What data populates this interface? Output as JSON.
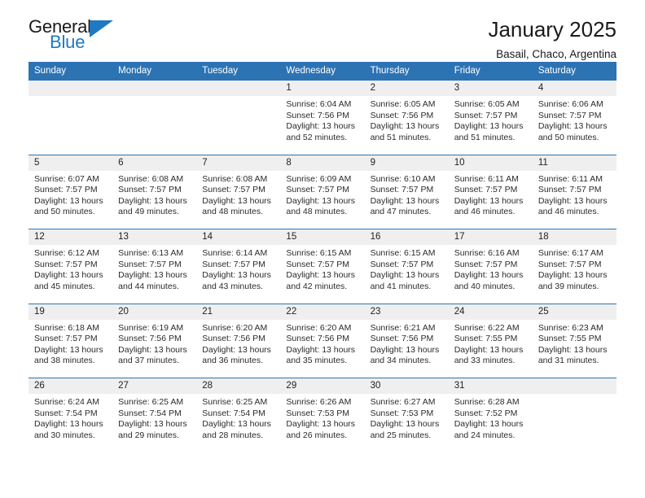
{
  "brand": {
    "name_top": "General",
    "name_bottom": "Blue",
    "triangle_color": "#1f78c1"
  },
  "header": {
    "title": "January 2025",
    "subtitle": "Basail, Chaco, Argentina"
  },
  "theme": {
    "header_blue": "#2c73b4",
    "date_band_gray": "#efefef",
    "text_dark": "#1a1a1a"
  },
  "calendar": {
    "weekdays": [
      "Sunday",
      "Monday",
      "Tuesday",
      "Wednesday",
      "Thursday",
      "Friday",
      "Saturday"
    ],
    "weeks": [
      [
        {
          "day": "",
          "empty": true,
          "lines": []
        },
        {
          "day": "",
          "empty": true,
          "lines": []
        },
        {
          "day": "",
          "empty": true,
          "lines": []
        },
        {
          "day": "1",
          "empty": false,
          "lines": [
            "Sunrise: 6:04 AM",
            "Sunset: 7:56 PM",
            "Daylight: 13 hours",
            "and 52 minutes."
          ]
        },
        {
          "day": "2",
          "empty": false,
          "lines": [
            "Sunrise: 6:05 AM",
            "Sunset: 7:56 PM",
            "Daylight: 13 hours",
            "and 51 minutes."
          ]
        },
        {
          "day": "3",
          "empty": false,
          "lines": [
            "Sunrise: 6:05 AM",
            "Sunset: 7:57 PM",
            "Daylight: 13 hours",
            "and 51 minutes."
          ]
        },
        {
          "day": "4",
          "empty": false,
          "lines": [
            "Sunrise: 6:06 AM",
            "Sunset: 7:57 PM",
            "Daylight: 13 hours",
            "and 50 minutes."
          ]
        }
      ],
      [
        {
          "day": "5",
          "empty": false,
          "lines": [
            "Sunrise: 6:07 AM",
            "Sunset: 7:57 PM",
            "Daylight: 13 hours",
            "and 50 minutes."
          ]
        },
        {
          "day": "6",
          "empty": false,
          "lines": [
            "Sunrise: 6:08 AM",
            "Sunset: 7:57 PM",
            "Daylight: 13 hours",
            "and 49 minutes."
          ]
        },
        {
          "day": "7",
          "empty": false,
          "lines": [
            "Sunrise: 6:08 AM",
            "Sunset: 7:57 PM",
            "Daylight: 13 hours",
            "and 48 minutes."
          ]
        },
        {
          "day": "8",
          "empty": false,
          "lines": [
            "Sunrise: 6:09 AM",
            "Sunset: 7:57 PM",
            "Daylight: 13 hours",
            "and 48 minutes."
          ]
        },
        {
          "day": "9",
          "empty": false,
          "lines": [
            "Sunrise: 6:10 AM",
            "Sunset: 7:57 PM",
            "Daylight: 13 hours",
            "and 47 minutes."
          ]
        },
        {
          "day": "10",
          "empty": false,
          "lines": [
            "Sunrise: 6:11 AM",
            "Sunset: 7:57 PM",
            "Daylight: 13 hours",
            "and 46 minutes."
          ]
        },
        {
          "day": "11",
          "empty": false,
          "lines": [
            "Sunrise: 6:11 AM",
            "Sunset: 7:57 PM",
            "Daylight: 13 hours",
            "and 46 minutes."
          ]
        }
      ],
      [
        {
          "day": "12",
          "empty": false,
          "lines": [
            "Sunrise: 6:12 AM",
            "Sunset: 7:57 PM",
            "Daylight: 13 hours",
            "and 45 minutes."
          ]
        },
        {
          "day": "13",
          "empty": false,
          "lines": [
            "Sunrise: 6:13 AM",
            "Sunset: 7:57 PM",
            "Daylight: 13 hours",
            "and 44 minutes."
          ]
        },
        {
          "day": "14",
          "empty": false,
          "lines": [
            "Sunrise: 6:14 AM",
            "Sunset: 7:57 PM",
            "Daylight: 13 hours",
            "and 43 minutes."
          ]
        },
        {
          "day": "15",
          "empty": false,
          "lines": [
            "Sunrise: 6:15 AM",
            "Sunset: 7:57 PM",
            "Daylight: 13 hours",
            "and 42 minutes."
          ]
        },
        {
          "day": "16",
          "empty": false,
          "lines": [
            "Sunrise: 6:15 AM",
            "Sunset: 7:57 PM",
            "Daylight: 13 hours",
            "and 41 minutes."
          ]
        },
        {
          "day": "17",
          "empty": false,
          "lines": [
            "Sunrise: 6:16 AM",
            "Sunset: 7:57 PM",
            "Daylight: 13 hours",
            "and 40 minutes."
          ]
        },
        {
          "day": "18",
          "empty": false,
          "lines": [
            "Sunrise: 6:17 AM",
            "Sunset: 7:57 PM",
            "Daylight: 13 hours",
            "and 39 minutes."
          ]
        }
      ],
      [
        {
          "day": "19",
          "empty": false,
          "lines": [
            "Sunrise: 6:18 AM",
            "Sunset: 7:57 PM",
            "Daylight: 13 hours",
            "and 38 minutes."
          ]
        },
        {
          "day": "20",
          "empty": false,
          "lines": [
            "Sunrise: 6:19 AM",
            "Sunset: 7:56 PM",
            "Daylight: 13 hours",
            "and 37 minutes."
          ]
        },
        {
          "day": "21",
          "empty": false,
          "lines": [
            "Sunrise: 6:20 AM",
            "Sunset: 7:56 PM",
            "Daylight: 13 hours",
            "and 36 minutes."
          ]
        },
        {
          "day": "22",
          "empty": false,
          "lines": [
            "Sunrise: 6:20 AM",
            "Sunset: 7:56 PM",
            "Daylight: 13 hours",
            "and 35 minutes."
          ]
        },
        {
          "day": "23",
          "empty": false,
          "lines": [
            "Sunrise: 6:21 AM",
            "Sunset: 7:56 PM",
            "Daylight: 13 hours",
            "and 34 minutes."
          ]
        },
        {
          "day": "24",
          "empty": false,
          "lines": [
            "Sunrise: 6:22 AM",
            "Sunset: 7:55 PM",
            "Daylight: 13 hours",
            "and 33 minutes."
          ]
        },
        {
          "day": "25",
          "empty": false,
          "lines": [
            "Sunrise: 6:23 AM",
            "Sunset: 7:55 PM",
            "Daylight: 13 hours",
            "and 31 minutes."
          ]
        }
      ],
      [
        {
          "day": "26",
          "empty": false,
          "lines": [
            "Sunrise: 6:24 AM",
            "Sunset: 7:54 PM",
            "Daylight: 13 hours",
            "and 30 minutes."
          ]
        },
        {
          "day": "27",
          "empty": false,
          "lines": [
            "Sunrise: 6:25 AM",
            "Sunset: 7:54 PM",
            "Daylight: 13 hours",
            "and 29 minutes."
          ]
        },
        {
          "day": "28",
          "empty": false,
          "lines": [
            "Sunrise: 6:25 AM",
            "Sunset: 7:54 PM",
            "Daylight: 13 hours",
            "and 28 minutes."
          ]
        },
        {
          "day": "29",
          "empty": false,
          "lines": [
            "Sunrise: 6:26 AM",
            "Sunset: 7:53 PM",
            "Daylight: 13 hours",
            "and 26 minutes."
          ]
        },
        {
          "day": "30",
          "empty": false,
          "lines": [
            "Sunrise: 6:27 AM",
            "Sunset: 7:53 PM",
            "Daylight: 13 hours",
            "and 25 minutes."
          ]
        },
        {
          "day": "31",
          "empty": false,
          "lines": [
            "Sunrise: 6:28 AM",
            "Sunset: 7:52 PM",
            "Daylight: 13 hours",
            "and 24 minutes."
          ]
        },
        {
          "day": "",
          "empty": true,
          "lines": []
        }
      ]
    ]
  }
}
